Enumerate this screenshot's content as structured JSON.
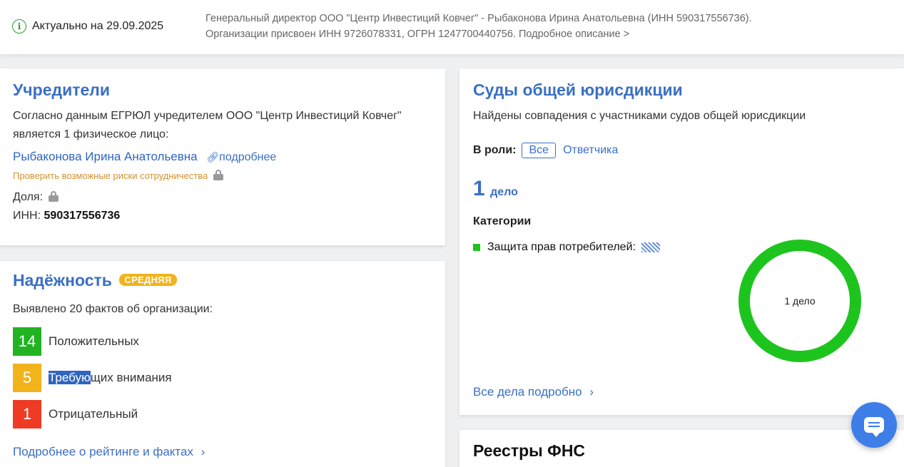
{
  "topbar": {
    "actual_label": "Актуально на 29.09.2025",
    "description_line1": "Генеральный директор ООО \"Центр Инвестиций Ковчег\" - Рыбаконова Ирина Анатольевна (ИНН 590317556736).",
    "description_line2": "Организации присвоен ИНН 9726078331, ОГРН 1247700440756. Подробное описание >"
  },
  "founders": {
    "title": "Учредители",
    "text": "Согласно данным ЕГРЮЛ учредителем ООО \"Центр Инвестиций Ковчег\" является 1 физическое лицо:",
    "person_name": "Рыбаконова Ирина Анатольевна",
    "details_link": "подробнее",
    "risk_link": "Проверить возможные риски сотрудничества",
    "share_label": "Доля:",
    "inn_label": "ИНН:",
    "inn_value": "590317556736"
  },
  "reliability": {
    "title": "Надёжность",
    "badge": "СРЕДНЯЯ",
    "summary": "Выявлено 20 фактов об организации:",
    "facts": [
      {
        "count": "14",
        "label": "Положительных",
        "color": "#22b322"
      },
      {
        "count": "5",
        "label_highlight": "Требую",
        "label_rest": "щих внимания",
        "color": "#f2b31b"
      },
      {
        "count": "1",
        "label": "Отрицательный",
        "color": "#ef3b24"
      }
    ],
    "more_link": "Подробнее о рейтинге и фактах"
  },
  "courts": {
    "title": "Суды общей юрисдикции",
    "text": "Найдены совпадения с участниками судов общей юрисдикции",
    "role_label": "В роли:",
    "role_all": "Все",
    "role_defendant": "Ответчика",
    "count": "1",
    "count_unit": "дело",
    "categories_title": "Категории",
    "category": "Защита прав потребителей:",
    "donut_label": "1 дело",
    "donut_color": "#1ec41e",
    "all_cases_link": "Все дела подробно"
  },
  "fns": {
    "title": "Реестры ФНС"
  }
}
